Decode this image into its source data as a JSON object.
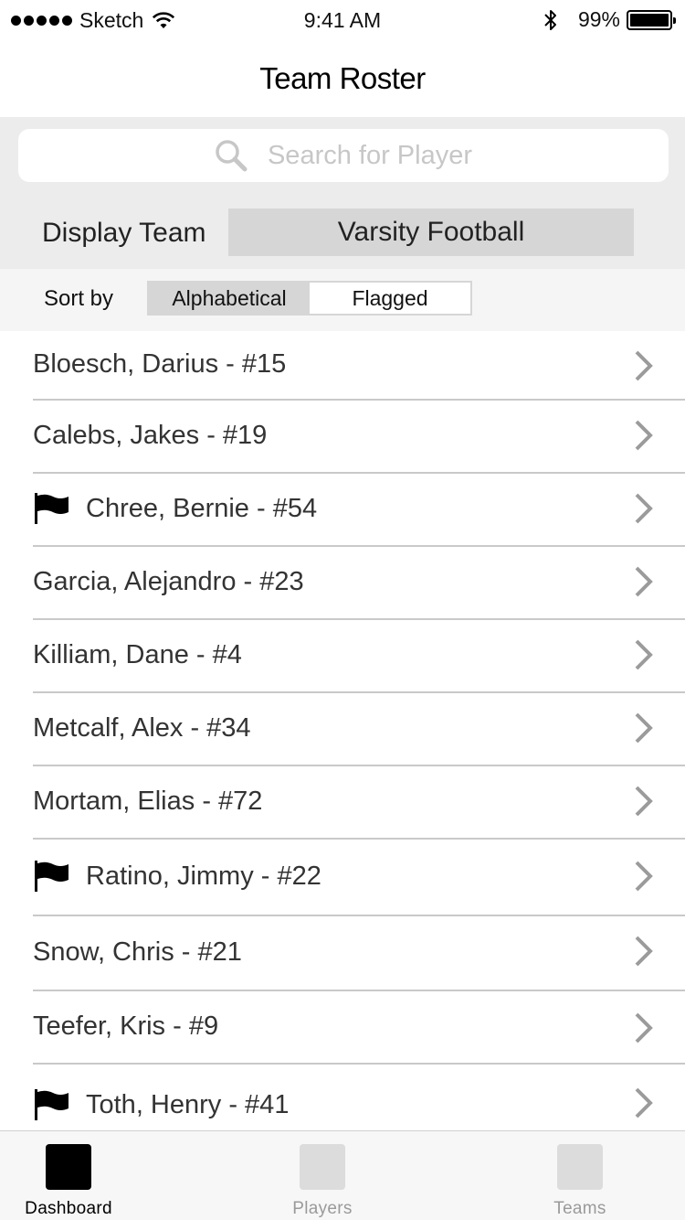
{
  "status_bar": {
    "carrier": "Sketch",
    "time": "9:41 AM",
    "battery": "99%"
  },
  "nav": {
    "title": "Team Roster"
  },
  "search": {
    "placeholder": "Search for Player"
  },
  "display_team": {
    "label": "Display Team",
    "value": "Varsity Football"
  },
  "sort": {
    "label": "Sort by",
    "options": [
      "Alphabetical",
      "Flagged"
    ],
    "selected": "Alphabetical"
  },
  "roster": [
    {
      "name": "Bloesch, Darius - #15",
      "flagged": false
    },
    {
      "name": "Calebs, Jakes - #19",
      "flagged": false
    },
    {
      "name": "Chree, Bernie - #54",
      "flagged": true
    },
    {
      "name": "Garcia, Alejandro - #23",
      "flagged": false
    },
    {
      "name": "Killiam, Dane - #4",
      "flagged": false
    },
    {
      "name": "Metcalf, Alex - #34",
      "flagged": false
    },
    {
      "name": "Mortam, Elias - #72",
      "flagged": false
    },
    {
      "name": "Ratino, Jimmy - #22",
      "flagged": true
    },
    {
      "name": "Snow, Chris - #21",
      "flagged": false
    },
    {
      "name": "Teefer, Kris - #9",
      "flagged": false
    },
    {
      "name": "Toth, Henry - #41",
      "flagged": true
    }
  ],
  "tab_bar": {
    "tabs": [
      {
        "label": "Dashboard",
        "active": true
      },
      {
        "label": "Players",
        "active": false
      },
      {
        "label": "Teams",
        "active": false
      }
    ]
  }
}
